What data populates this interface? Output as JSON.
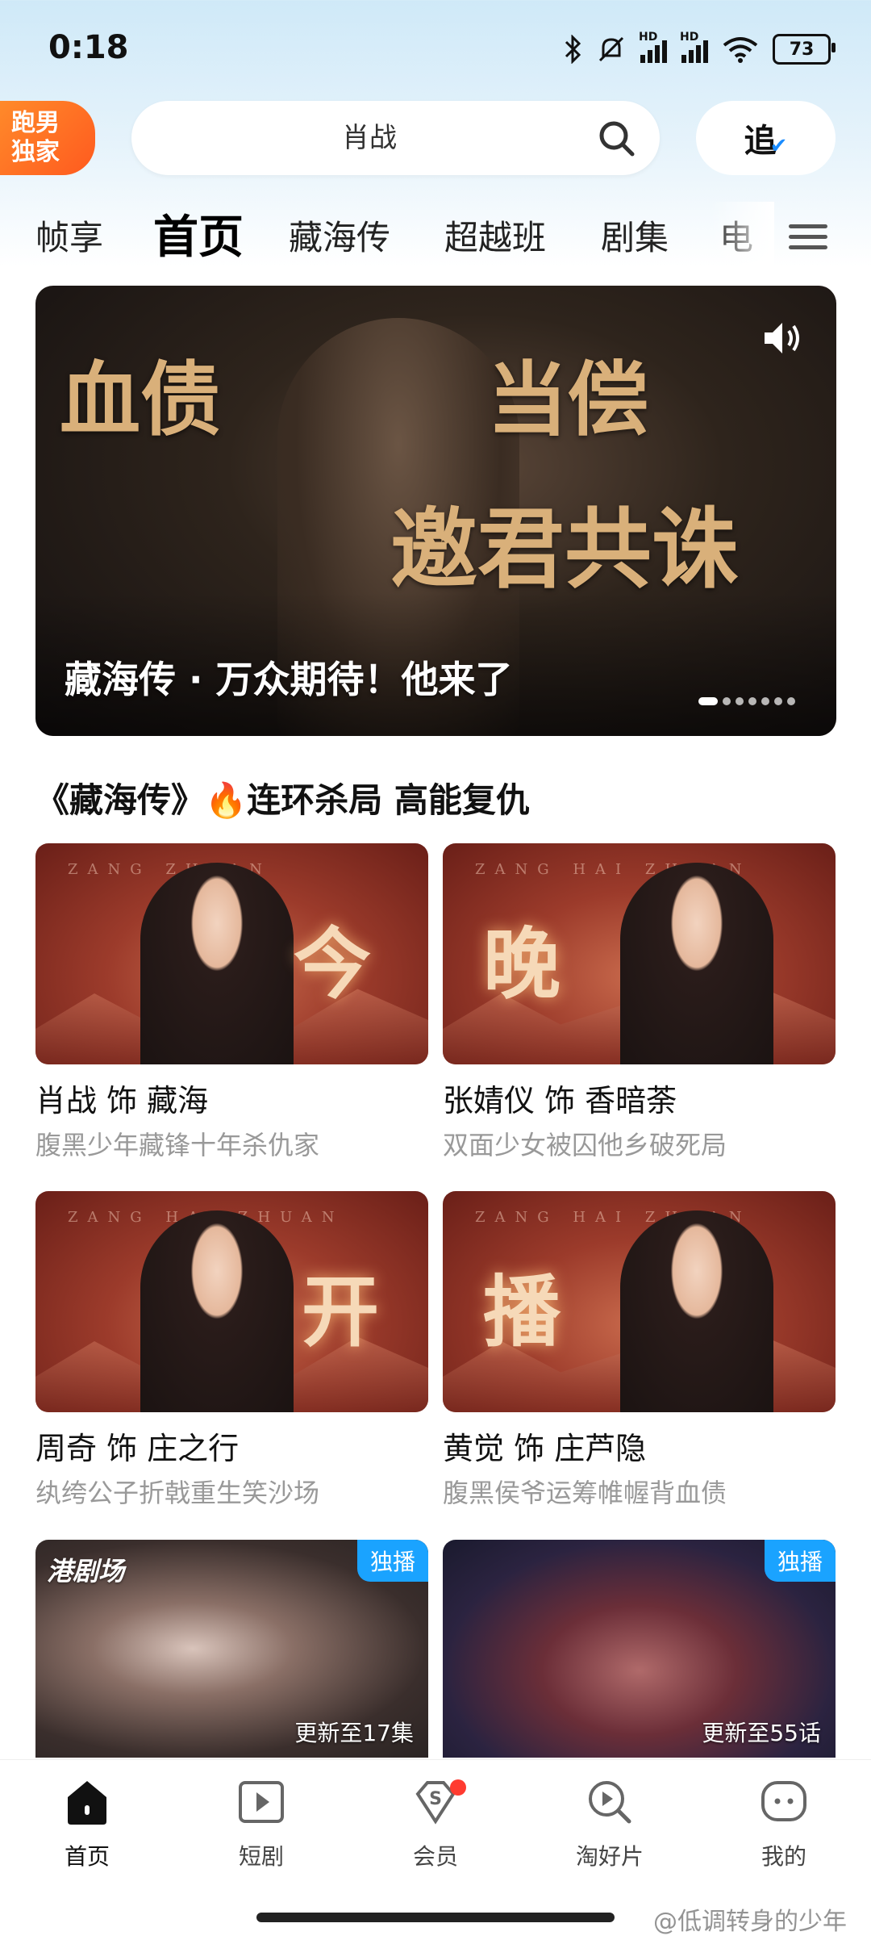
{
  "status_bar": {
    "time": "0:18",
    "battery": "73"
  },
  "header": {
    "brand_line1": "跑男",
    "brand_line2": "独家",
    "search_placeholder": "肖战",
    "follow_label": "追"
  },
  "tabs": [
    {
      "label": "帧享",
      "active": false
    },
    {
      "label": "首页",
      "active": true
    },
    {
      "label": "藏海传",
      "active": false
    },
    {
      "label": "超越班",
      "active": false
    },
    {
      "label": "剧集",
      "active": false
    },
    {
      "label": "电",
      "active": false
    }
  ],
  "banner": {
    "calligraphy_1": "血债",
    "calligraphy_2": "当偿",
    "calligraphy_3": "邀君共诛",
    "caption": "藏海传 · 万众期待！他来了",
    "dot_count": 7,
    "active_dot": 0
  },
  "section": {
    "title": "《藏海传》🔥连环杀局 高能复仇"
  },
  "cards": [
    {
      "char": "今",
      "title": "肖战 饰 藏海",
      "subtitle": "腹黑少年藏锋十年杀仇家",
      "watermark": "ZANG  ZHUAN"
    },
    {
      "char": "晚",
      "title": "张婧仪 饰 香暗荼",
      "subtitle": "双面少女被囚他乡破死局",
      "watermark": "ZANG HAI ZHUAN"
    },
    {
      "char": "开",
      "title": "周奇 饰 庄之行",
      "subtitle": "纨绔公子折戟重生笑沙场",
      "watermark": "ZANG HAI ZHUAN"
    },
    {
      "char": "播",
      "title": "黄觉 饰 庄芦隐",
      "subtitle": "腹黑侯爷运筹帷幄背血债",
      "watermark": "ZANG HAI ZHUAN"
    }
  ],
  "bottom_cards": [
    {
      "logo": "港剧场",
      "badge": "独播",
      "update": "更新至17集"
    },
    {
      "badge": "独播",
      "update": "更新至55话"
    }
  ],
  "bottom_nav": [
    {
      "label": "首页",
      "icon": "home-icon",
      "active": true
    },
    {
      "label": "短剧",
      "icon": "play-square-icon",
      "active": false
    },
    {
      "label": "会员",
      "icon": "vip-diamond-icon",
      "active": false
    },
    {
      "label": "淘好片",
      "icon": "search-play-icon",
      "active": false
    },
    {
      "label": "我的",
      "icon": "profile-face-icon",
      "active": false
    }
  ],
  "watermark": "@低调转身的少年",
  "colors": {
    "accent_blue": "#1aa3ff",
    "brand_orange": "#ff6a21",
    "banner_gold": "#d9b07a",
    "notification_red": "#ff3b30"
  }
}
